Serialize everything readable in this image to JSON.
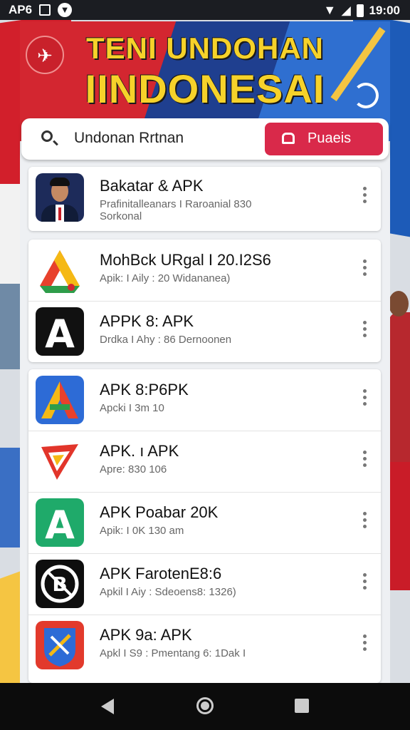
{
  "status_bar": {
    "carrier": "AP6",
    "time": "19:00",
    "icons": [
      "image-icon",
      "shield-icon",
      "wifi-icon",
      "signal-icon",
      "battery-icon"
    ]
  },
  "header": {
    "title_line1": "TENI UNDOHAN",
    "title_line2": "IINDONESAI"
  },
  "search": {
    "value": "Undonan Rrtnan",
    "button_label": "Puaeis"
  },
  "groups": [
    {
      "items": [
        {
          "name": "Bakatar & APK",
          "sub": "Prafinitalleanars I Raroanial 830",
          "sub2": "Sorkonal",
          "icon": "person-photo-icon"
        }
      ]
    },
    {
      "items": [
        {
          "name": "MohBck URgal I 20.I2S6",
          "sub": "Apik: I Aily : 20 Widananea)",
          "icon": "drive-triangle-icon"
        },
        {
          "name": "APPK 8: APK",
          "sub": "Drdka I Ahy : 86 Dernoonen",
          "icon": "a-letter-black-icon"
        }
      ]
    },
    {
      "items": [
        {
          "name": "APK 8:P6PK",
          "sub": "Apcki I 3m 10",
          "icon": "a-multicolor-icon"
        },
        {
          "name": "APK. ı APK",
          "sub": "Apre: 830 106",
          "icon": "play-red-icon"
        },
        {
          "name": "APK Poabar 20K",
          "sub": "Apik: I 0K 130 am",
          "icon": "a-green-icon"
        },
        {
          "name": "APK FarotenE8:6",
          "sub": "Apkil I Aiy : Sdeoens8: 1326)",
          "icon": "b-badge-icon"
        },
        {
          "name": "APK 9a: APK",
          "sub": "Apkl I S9 : Pmentang 6: 1Dak I",
          "icon": "shield-blue-icon"
        }
      ]
    }
  ],
  "colors": {
    "accent_red": "#d9294a",
    "banner_blue": "#1f3f8f",
    "banner_red": "#d32630",
    "title_yellow": "#f6d22a"
  }
}
